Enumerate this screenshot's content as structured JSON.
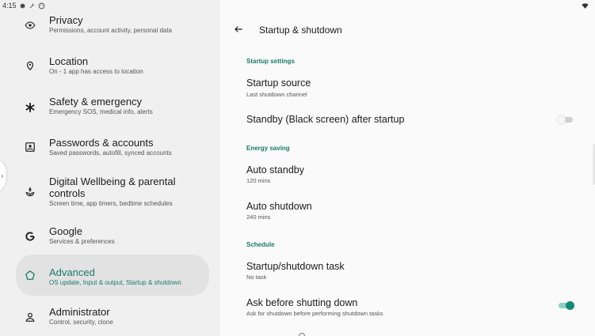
{
  "status_bar": {
    "time": "4:15"
  },
  "sidebar": {
    "items": [
      {
        "title": "Privacy",
        "subtitle": "Permissions, account activity, personal data",
        "icon": "privacy-icon"
      },
      {
        "title": "Location",
        "subtitle": "On - 1 app has access to location",
        "icon": "location-pin-icon"
      },
      {
        "title": "Safety & emergency",
        "subtitle": "Emergency SOS, medical info, alerts",
        "icon": "asterisk-icon"
      },
      {
        "title": "Passwords & accounts",
        "subtitle": "Saved passwords, autofill, synced accounts",
        "icon": "account-box-icon"
      },
      {
        "title_line1": "Digital Wellbeing & parental",
        "title_line2": "controls",
        "subtitle": "Screen time, app timers, bedtime schedules",
        "icon": "wellbeing-icon"
      },
      {
        "title": "Google",
        "subtitle": "Services & preferences",
        "icon": "google-icon"
      },
      {
        "title": "Advanced",
        "subtitle": "OS update, Input & output, Startup & shutdown",
        "icon": "advanced-icon",
        "selected": true
      },
      {
        "title": "Administrator",
        "subtitle": "Control, security, clone",
        "icon": "person-icon"
      }
    ]
  },
  "page": {
    "title": "Startup & shutdown",
    "sections": [
      {
        "header": "Startup settings"
      },
      {
        "header": "Energy saving"
      },
      {
        "header": "Schedule"
      }
    ],
    "prefs": {
      "startup_source": {
        "title": "Startup source",
        "subtitle": "Last shutdown channel"
      },
      "standby_after_startup": {
        "title": "Standby (Black screen) after startup",
        "toggle": false
      },
      "auto_standby": {
        "title": "Auto standby",
        "subtitle": "120 mins"
      },
      "auto_shutdown": {
        "title": "Auto shutdown",
        "subtitle": "240 mins"
      },
      "startup_shutdown_task": {
        "title": "Startup/shutdown task",
        "subtitle": "No task"
      },
      "ask_before_shutdown": {
        "title": "Ask before shutting down",
        "subtitle": "Ask for shutdown before performing shutdown tasks",
        "toggle": true
      }
    }
  },
  "colors": {
    "accent": "#1a7a6a",
    "toggle_on": "#138a78",
    "selected_bg": "#e2e2e2",
    "left_bg": "#f0f0f0",
    "right_bg": "#fafafa"
  }
}
